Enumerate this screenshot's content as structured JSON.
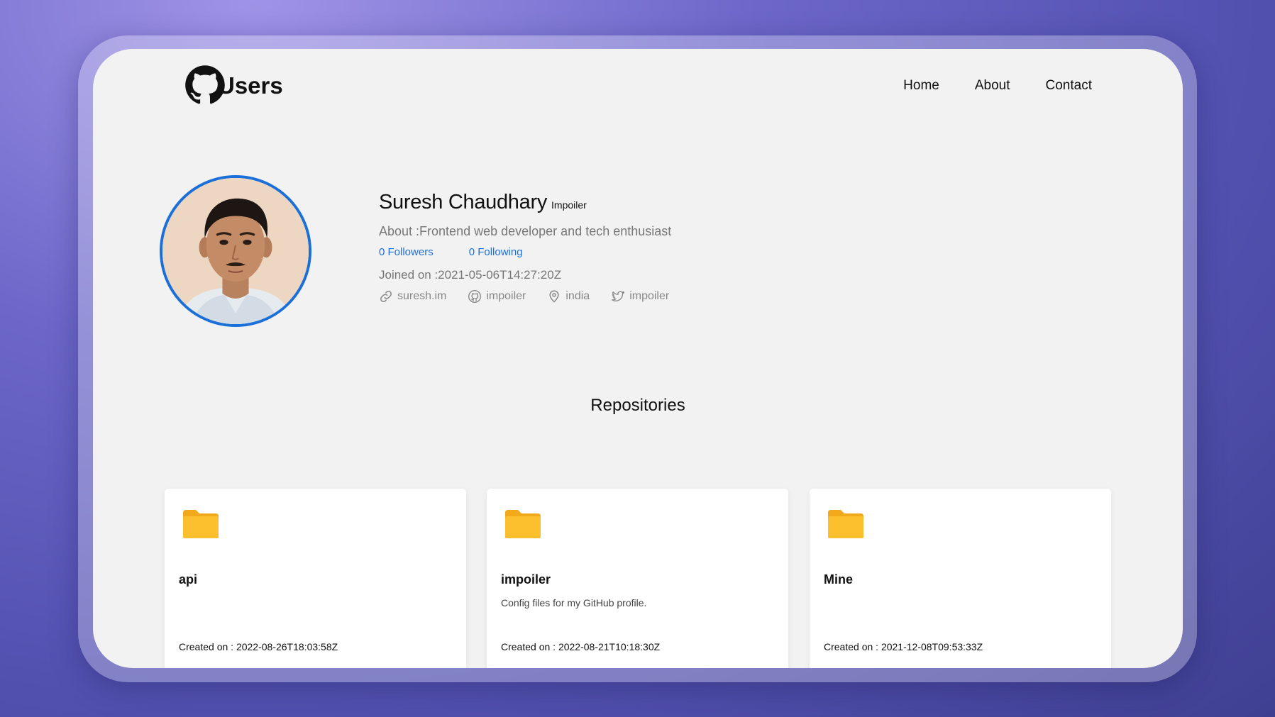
{
  "header": {
    "logo_text": "Users",
    "nav": [
      "Home",
      "About",
      "Contact"
    ]
  },
  "profile": {
    "name": "Suresh Chaudhary",
    "login": "Impoiler",
    "about": "About :Frontend web developer and tech enthusiast",
    "followers": "0 Followers",
    "following": "0 Following",
    "joined": "Joined on :2021-05-06T14:27:20Z",
    "links": {
      "website": "suresh.im",
      "github": "impoiler",
      "location": "india",
      "twitter": "impoiler"
    }
  },
  "repositories": {
    "title": "Repositories",
    "items": [
      {
        "name": "api",
        "description": "",
        "created": "Created on : 2022-08-26T18:03:58Z"
      },
      {
        "name": "impoiler",
        "description": "Config files for my GitHub profile.",
        "created": "Created on : 2022-08-21T10:18:30Z"
      },
      {
        "name": "Mine",
        "description": "",
        "created": "Created on : 2021-12-08T09:53:33Z"
      }
    ]
  },
  "colors": {
    "accent": "#1a6fd9",
    "folder": "#fcc02f",
    "window_bg": "#f2f2f2"
  },
  "icons": [
    "github-logo-icon",
    "link-icon",
    "github-icon",
    "location-pin-icon",
    "twitter-icon",
    "folder-icon"
  ]
}
